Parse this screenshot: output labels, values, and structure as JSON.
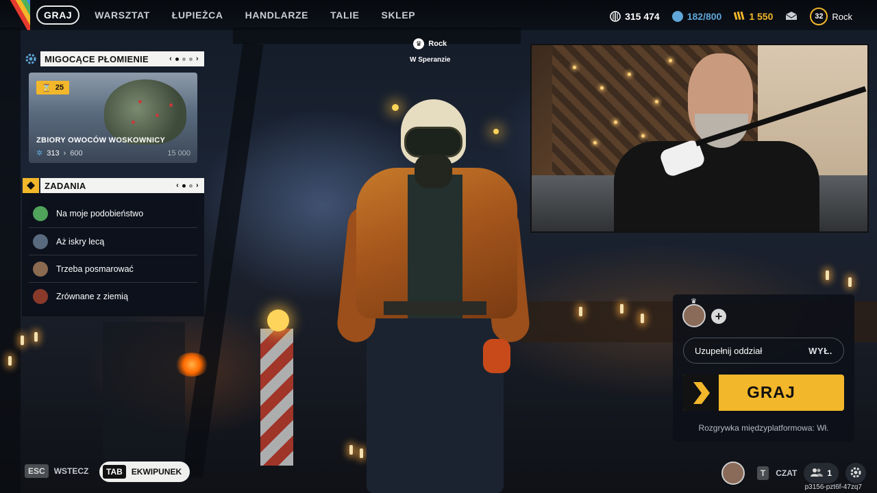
{
  "nav": {
    "items": [
      {
        "label": "GRAJ",
        "active": true
      },
      {
        "label": "WARSZTAT",
        "active": false
      },
      {
        "label": "ŁUPIEŻCA",
        "active": false
      },
      {
        "label": "HANDLARZE",
        "active": false
      },
      {
        "label": "TALIE",
        "active": false
      },
      {
        "label": "SKLEP",
        "active": false
      }
    ]
  },
  "currencies": {
    "cash": {
      "value": "315 474",
      "icon": "cash-icon",
      "color": "#ffffff"
    },
    "backpack": {
      "value": "182/800",
      "icon": "backpack-icon",
      "color": "#5fa7d8"
    },
    "tickets": {
      "value": "1 550",
      "icon": "token-icon",
      "color": "#f2b72a"
    },
    "inbox_icon": "mail-icon",
    "level": "32",
    "username": "Rock"
  },
  "event": {
    "title": "MIGOCĄCE PŁOMIENIE",
    "badge": "25",
    "card_title": "ZBIORY OWOCÓW WOSKOWNICY",
    "progress_current": "313",
    "progress_next": "600",
    "progress_max": "15 000",
    "pager_prev": "‹",
    "pager_next": "›"
  },
  "tasks": {
    "title": "ZADANIA",
    "items": [
      {
        "label": "Na moje podobieństwo",
        "color": "#4fa35a"
      },
      {
        "label": "Aż iskry lecą",
        "color": "#5a6a7e"
      },
      {
        "label": "Trzeba posmarować",
        "color": "#8a6a50"
      },
      {
        "label": "Zrównane z ziemią",
        "color": "#8a3a2a"
      }
    ]
  },
  "player_marker": {
    "name": "Rock",
    "location": "W Speranzie"
  },
  "squad": {
    "fill_label": "Uzupełnij oddział",
    "fill_value": "WYŁ.",
    "play_label": "GRAJ",
    "crossplay": "Rozgrywka międzyplatformowa: Wł.",
    "accent": "#f2b72a"
  },
  "bottom": {
    "esc_key": "ESC",
    "esc_label": "WSTECZ",
    "tab_key": "TAB",
    "tab_label": "EKWIPUNEK",
    "chat_key": "T",
    "chat_label": "CZAT",
    "friends_count": "1",
    "build_id": "p3156-pzt6f-47zq7"
  }
}
